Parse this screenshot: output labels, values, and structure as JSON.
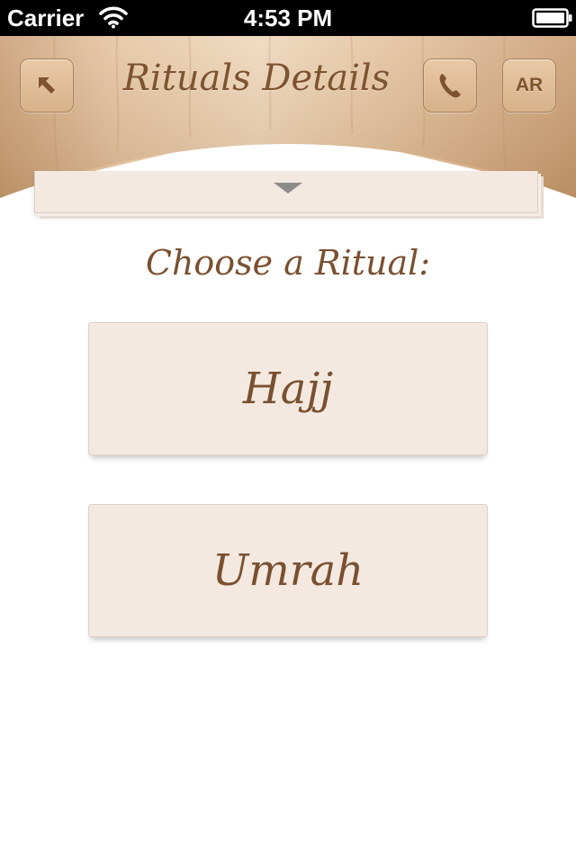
{
  "status_bar": {
    "carrier": "Carrier",
    "time": "4:53 PM"
  },
  "header": {
    "title": "Rituals Details",
    "language_button_label": "AR",
    "icons": {
      "back": "back-arrow-icon",
      "call": "phone-icon"
    }
  },
  "main": {
    "prompt": "Choose a Ritual:",
    "rituals": [
      {
        "label": "Hajj"
      },
      {
        "label": "Umrah"
      }
    ]
  },
  "colors": {
    "wood_light": "#e8c9a5",
    "wood_dark": "#c89e73",
    "text_brown": "#7a5030",
    "panel_beige": "#f3e9e1"
  }
}
